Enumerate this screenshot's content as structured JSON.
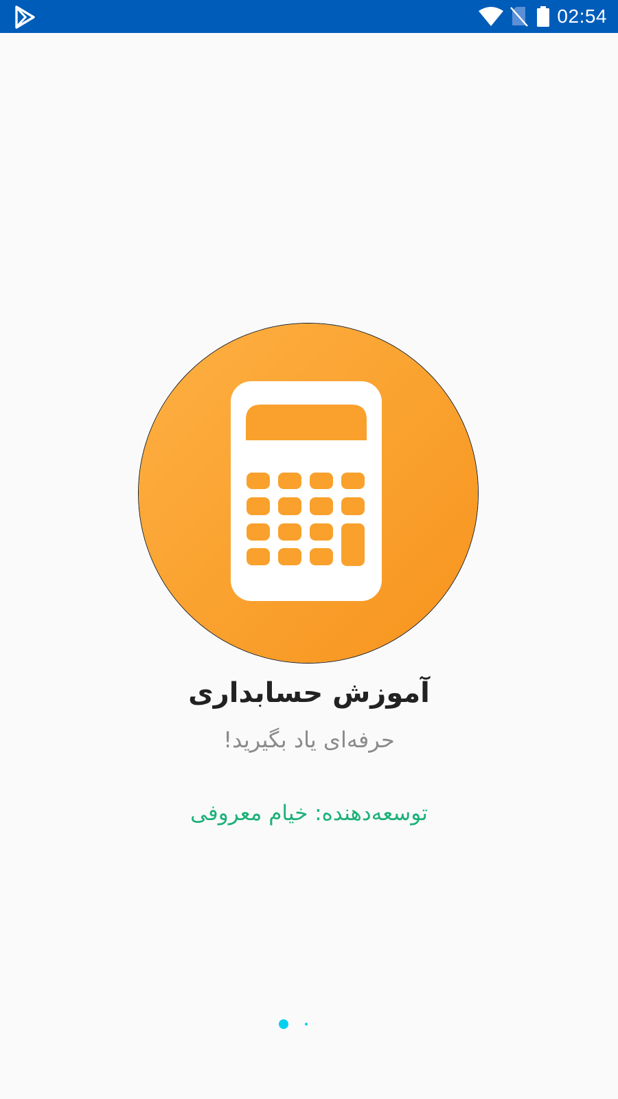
{
  "status_bar": {
    "time": "02:54",
    "background_color": "#005cb9",
    "icons": [
      "play-logo-icon",
      "wifi-icon",
      "no-sim-icon",
      "battery-icon"
    ]
  },
  "splash": {
    "logo_icon": "calculator-icon",
    "logo_gradient": [
      "#fdb043",
      "#f7941d"
    ],
    "title": "آموزش حسابداری",
    "subtitle": "حرفه‌ای یاد بگیرید!",
    "developer": "توسعه‌دهنده: خیام معروفی",
    "developer_color": "#1db17a"
  },
  "pager": {
    "page_count": 2,
    "active_index": 0,
    "color": "#00d0f0"
  }
}
